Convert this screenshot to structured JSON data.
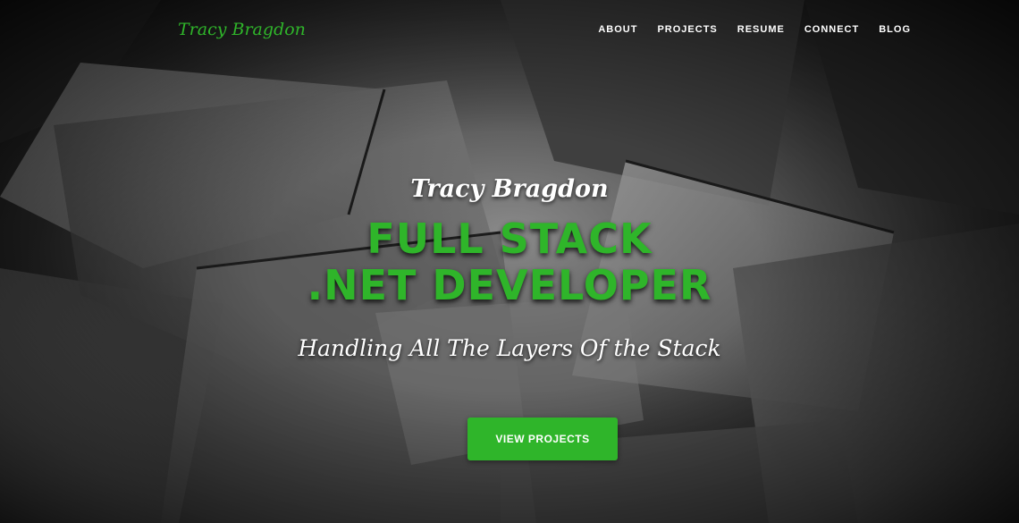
{
  "brand": {
    "name": "Tracy Bragdon"
  },
  "nav": {
    "items": [
      {
        "label": "ABOUT"
      },
      {
        "label": "PROJECTS"
      },
      {
        "label": "RESUME"
      },
      {
        "label": "CONNECT"
      },
      {
        "label": "BLOG"
      }
    ]
  },
  "hero": {
    "name": "Tracy Bragdon",
    "title_line1": "FULL STACK",
    "title_line2": ".NET DEVELOPER",
    "tagline": "Handling All The Layers Of the Stack",
    "cta_label": "VIEW PROJECTS"
  },
  "colors": {
    "accent": "#2fb52a",
    "text": "#ffffff",
    "background": "#1a1a1a"
  }
}
